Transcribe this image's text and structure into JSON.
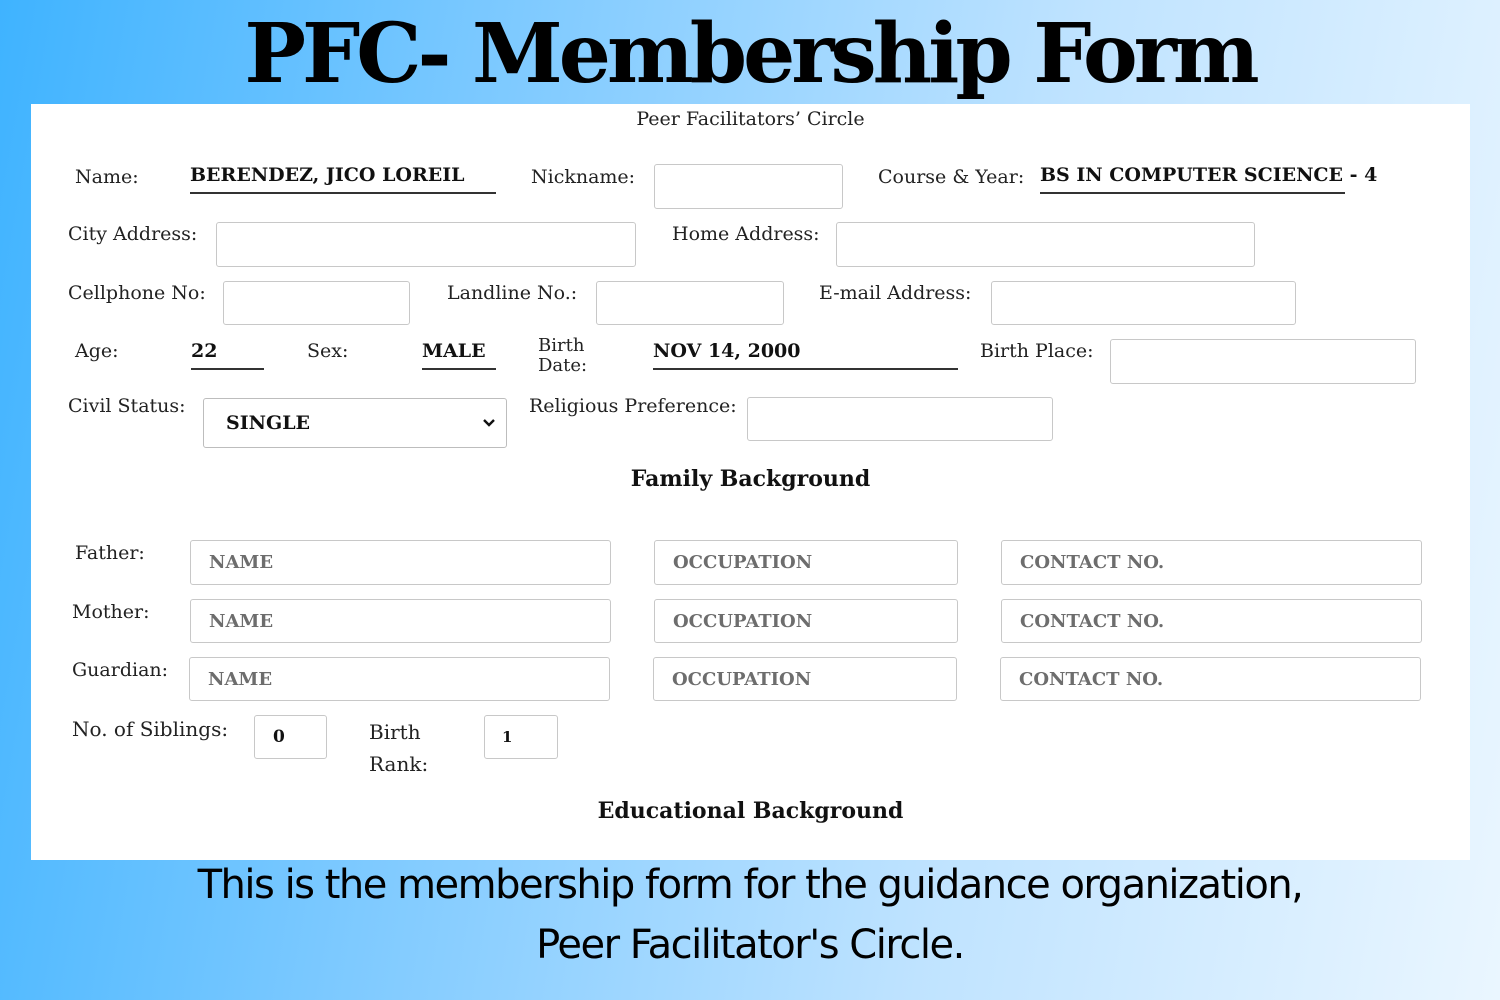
{
  "banner": {
    "title": "PFC- Membership Form"
  },
  "form": {
    "org_name": "Peer Facilitators’ Circle",
    "name_label": "Name:",
    "name_value": "BERENDEZ, JICO LOREIL",
    "nickname_label": "Nickname:",
    "nickname_value": "",
    "course_label": "Course & Year:",
    "course_value": "BS IN COMPUTER SCIENCE - 4",
    "city_address_label": "City Address:",
    "home_address_label": "Home Address:",
    "cellphone_label": "Cellphone No:",
    "landline_label": "Landline No.:",
    "email_label": "E-mail Address:",
    "age_label": "Age:",
    "age_value": "22",
    "sex_label": "Sex:",
    "sex_value": "MALE",
    "birth_date_label_1": "Birth",
    "birth_date_label_2": "Date:",
    "birth_date_value": "NOV 14, 2000",
    "birth_place_label": "Birth Place:",
    "civil_status_label": "Civil Status:",
    "civil_status_value": "SINGLE",
    "religion_label": "Religious Preference:",
    "family_section": "Family Background",
    "family_rows": [
      {
        "label": "Father:",
        "name_ph": "NAME",
        "occupation_ph": "OCCUPATION",
        "contact_ph": "CONTACT NO."
      },
      {
        "label": "Mother:",
        "name_ph": "NAME",
        "occupation_ph": "OCCUPATION",
        "contact_ph": "CONTACT NO."
      },
      {
        "label": "Guardian:",
        "name_ph": "NAME",
        "occupation_ph": "OCCUPATION",
        "contact_ph": "CONTACT NO."
      }
    ],
    "siblings_label": "No. of Siblings:",
    "siblings_value": "0",
    "birth_rank_label_1": "Birth",
    "birth_rank_label_2": "Rank:",
    "birth_rank_value": "1",
    "education_section": "Educational Background"
  },
  "caption": {
    "line1": "This is the membership form for the guidance organization,",
    "line2": "Peer Facilitator's Circle."
  },
  "icons": {
    "select_arrow": "chevron-down-icon"
  }
}
